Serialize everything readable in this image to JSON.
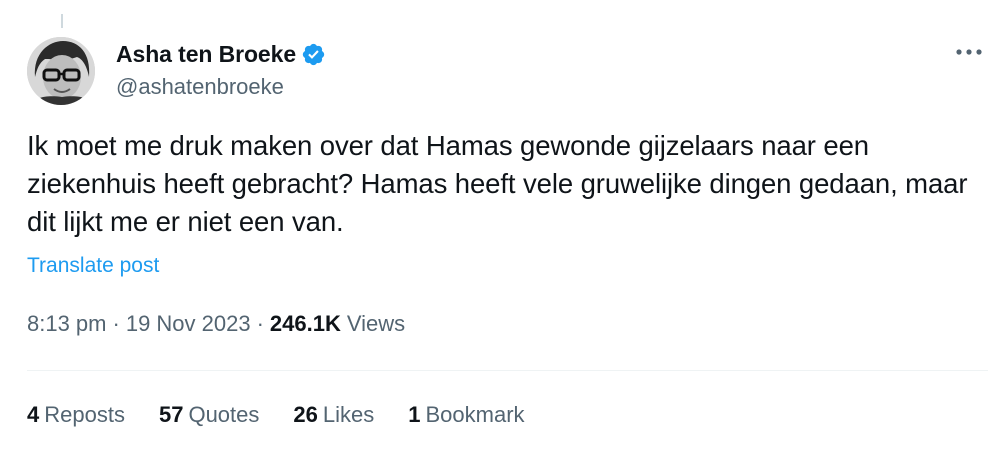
{
  "author": {
    "display_name": "Asha ten Broeke",
    "handle": "@ashatenbroeke",
    "verified": true,
    "avatar_icon": "profile-photo-woman-with-glasses"
  },
  "tweet": {
    "text": "Ik moet me druk maken over dat Hamas gewonde gijzelaars naar een ziekenhuis heeft gebracht? Hamas heeft vele gruwelijke dingen gedaan, maar dit lijkt me er niet een van.",
    "translate_label": "Translate post"
  },
  "meta": {
    "time": "8:13 pm",
    "separator": "·",
    "date": "19 Nov 2023",
    "views_count": "246.1K",
    "views_label": "Views"
  },
  "stats": {
    "reposts": {
      "count": "4",
      "label": "Reposts"
    },
    "quotes": {
      "count": "57",
      "label": "Quotes"
    },
    "likes": {
      "count": "26",
      "label": "Likes"
    },
    "bookmarks": {
      "count": "1",
      "label": "Bookmark"
    }
  },
  "colors": {
    "accent_blue": "#1d9bf0",
    "text_primary": "#0f1419",
    "text_secondary": "#536471",
    "divider": "#eff3f4"
  },
  "icons": {
    "verified": "verified-badge-icon",
    "more": "more-dots-icon"
  }
}
